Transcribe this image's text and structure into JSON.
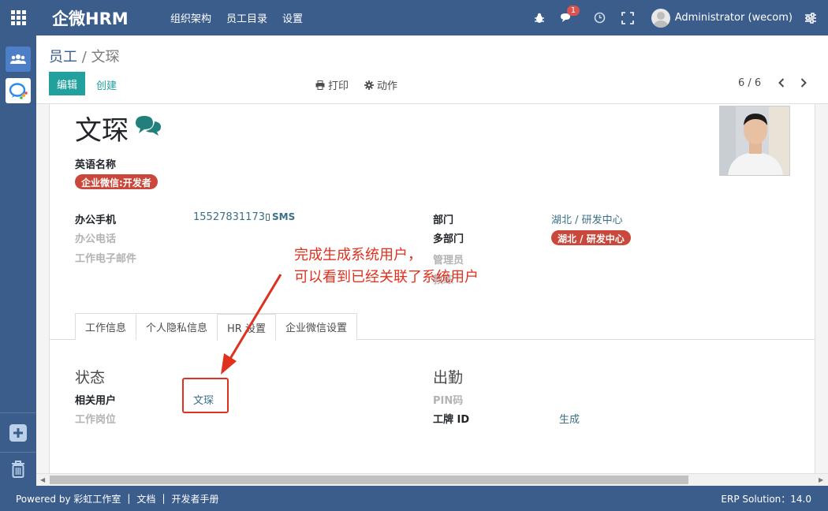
{
  "navbar": {
    "brand": "企微HRM",
    "menu": [
      "组织架构",
      "员工目录",
      "设置"
    ],
    "notification_count": "1",
    "user_name": "Administrator (wecom)"
  },
  "breadcrumb": {
    "parent": "员工",
    "separator": " / ",
    "current": "文琛"
  },
  "toolbar": {
    "edit": "编辑",
    "create": "创建",
    "print": "打印",
    "action": "动作",
    "pager": "6 / 6"
  },
  "employee": {
    "name": "文琛",
    "english_name_label": "英语名称",
    "wecom_tag": "企业微信:开发者",
    "work_mobile_label": "办公手机",
    "work_mobile": "15527831173",
    "sms": "SMS",
    "work_phone_label": "办公电话",
    "work_email_label": "工作电子邮件",
    "department_label": "部门",
    "department": "湖北 / 研发中心",
    "multi_department_label": "多部门",
    "multi_department_tag": "湖北 / 研发中心",
    "manager_label": "管理员",
    "coach_label": "教练"
  },
  "tabs": [
    "工作信息",
    "个人隐私信息",
    "HR 设置",
    "企业微信设置"
  ],
  "hr_settings": {
    "status_title": "状态",
    "related_user_label": "相关用户",
    "related_user": "文琛",
    "job_position_label": "工作岗位",
    "attendance_title": "出勤",
    "pin_label": "PIN码",
    "badge_id_label": "工牌 ID",
    "badge_generate": "生成"
  },
  "annotation": {
    "line1": "完成生成系统用户，",
    "line2": "可以看到已经关联了系统用户"
  },
  "footer": {
    "powered_by": "Powered by 彩虹工作室",
    "docs": "文档",
    "dev_manual": "开发者手册",
    "sep": "|",
    "version": "ERP Solution：14.0"
  },
  "colors": {
    "navbar": "#3b5d8c",
    "primary_button": "#21a09e",
    "tag_red": "#c9483b",
    "annotation_red": "#e0301e",
    "link": "#3b6f87"
  }
}
